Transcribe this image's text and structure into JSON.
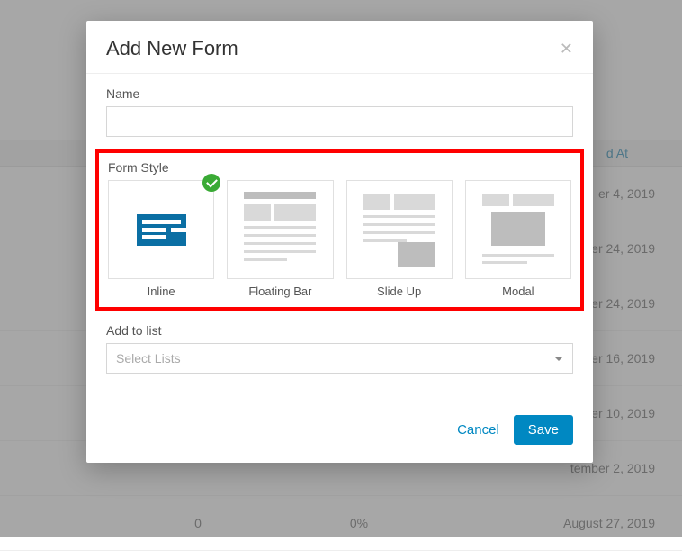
{
  "background": {
    "header_col": "d At",
    "rows": [
      {
        "num": "",
        "pct": "",
        "date": "er 4, 2019"
      },
      {
        "num": "",
        "pct": "",
        "date": "nber 24, 2019"
      },
      {
        "num": "",
        "pct": "",
        "date": "nber 24, 2019"
      },
      {
        "num": "",
        "pct": "",
        "date": "ember 16, 2019"
      },
      {
        "num": "",
        "pct": "",
        "date": "ember 10, 2019"
      },
      {
        "num": "",
        "pct": "",
        "date": "tember 2, 2019"
      },
      {
        "num": "0",
        "pct": "0%",
        "date": "August 27, 2019"
      }
    ]
  },
  "modal": {
    "title": "Add New Form",
    "name_label": "Name",
    "name_value": "",
    "form_style_label": "Form Style",
    "styles": [
      {
        "label": "Inline",
        "selected": true
      },
      {
        "label": "Floating Bar",
        "selected": false
      },
      {
        "label": "Slide Up",
        "selected": false
      },
      {
        "label": "Modal",
        "selected": false
      }
    ],
    "add_to_list_label": "Add to list",
    "select_placeholder": "Select Lists",
    "cancel_label": "Cancel",
    "save_label": "Save"
  }
}
